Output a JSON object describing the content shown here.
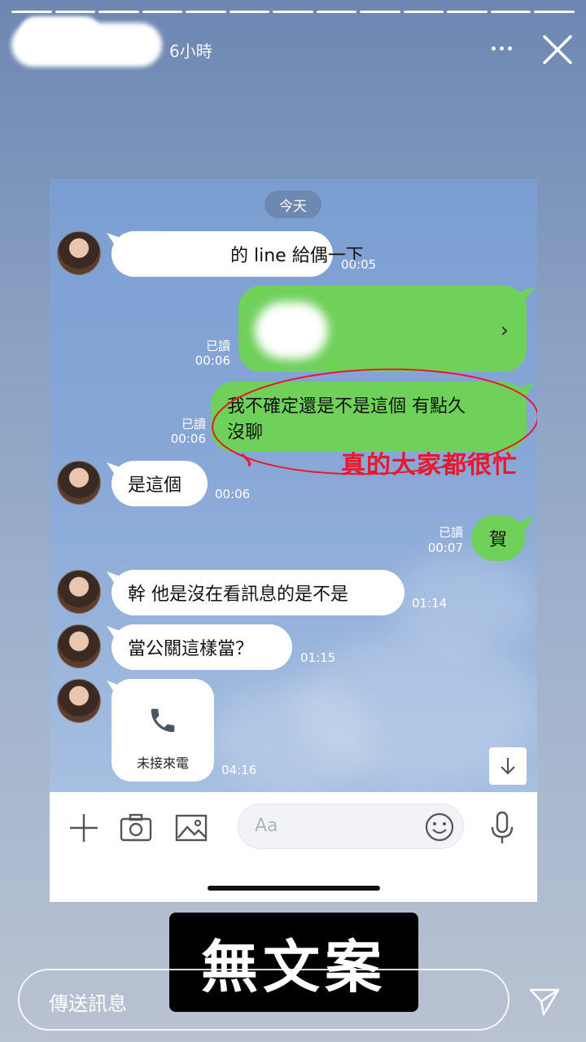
{
  "story": {
    "time_ago": "6小時",
    "progress_segments": 13
  },
  "chat": {
    "date_label": "今天",
    "read_label": "已讀",
    "messages": [
      {
        "dir": "in",
        "text": "的 line 給偶一下",
        "time": "00:05"
      },
      {
        "dir": "out",
        "type": "contact_card",
        "time": "00:06"
      },
      {
        "dir": "out",
        "text_line1": "我不確定還是不是這個 有點久",
        "text_line2": "沒聊",
        "time": "00:06"
      },
      {
        "dir": "in",
        "text": "是這個",
        "time": "00:06"
      },
      {
        "dir": "out",
        "text": "賀",
        "time": "00:07"
      },
      {
        "dir": "in",
        "text": "幹 他是沒在看訊息的是不是",
        "time": "01:14"
      },
      {
        "dir": "in",
        "text": "當公關這樣當？",
        "time": "01:15"
      },
      {
        "dir": "in",
        "type": "missed_call",
        "text": "未接來電",
        "time": "04:16"
      }
    ],
    "annotation": "真的大家都很忙",
    "annotation_color": "#e8192c",
    "input_placeholder": "Aa"
  },
  "caption": "無文案",
  "reply_placeholder": "傳送訊息",
  "colors": {
    "outgoing_bubble": "#6fd05a",
    "incoming_bubble": "#ffffff",
    "chat_background": "#87a7d6"
  }
}
